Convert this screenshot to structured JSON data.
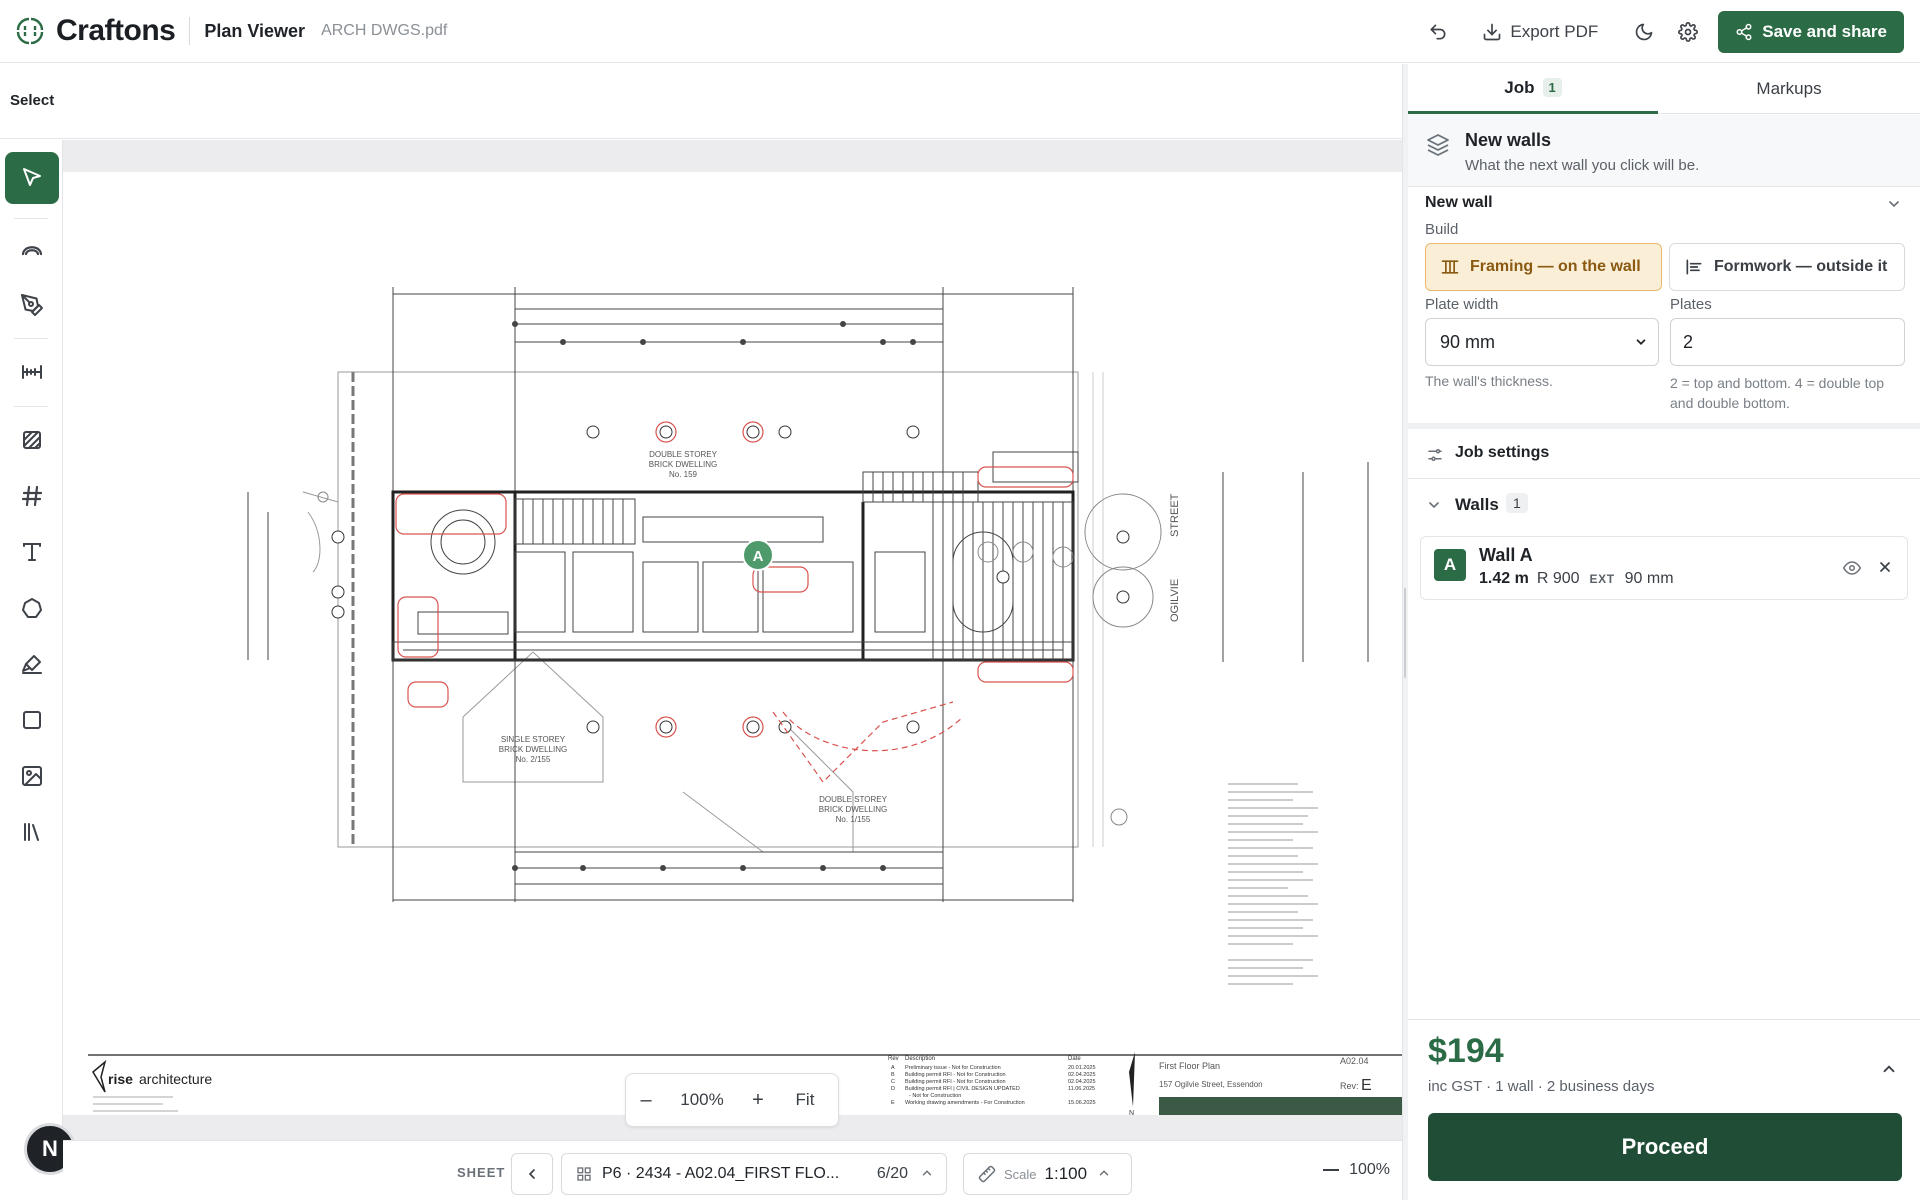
{
  "header": {
    "brand": "Craftons",
    "app_title": "Plan Viewer",
    "file_name": "ARCH DWGS.pdf",
    "export_label": "Export PDF",
    "save_label": "Save and share"
  },
  "mode": {
    "label": "Select"
  },
  "toolbar": {
    "tools": [
      "select-icon",
      "arc-icon",
      "pen-icon",
      "ruler-icon",
      "hatch-icon",
      "grid-icon",
      "text-icon",
      "polygon-icon",
      "highlighter-icon",
      "rectangle-icon",
      "image-icon",
      "library-icon"
    ],
    "active": "select-icon"
  },
  "user": {
    "initial": "N"
  },
  "canvas": {
    "markers": {
      "wall": "A"
    },
    "labels": {
      "double_storey": "DOUBLE STOREY",
      "brick_dwelling": "BRICK DWELLING",
      "no_159": "No. 159",
      "single_storey": "SINGLE STOREY",
      "no_2155": "No. 2/155",
      "no_1155": "No. 1/155",
      "street": "STREET",
      "ogilvie": "OGILVIE"
    },
    "titleblock": {
      "logo_rise": "rise",
      "logo_arch": "architecture",
      "rev_header": "Rev",
      "desc_header": "Description",
      "date_header": "Date",
      "revisions": [
        {
          "rev": "A",
          "desc": "Preliminary issue - Not for Construction",
          "date": "20.01.2025"
        },
        {
          "rev": "B",
          "desc": "Building permit RFI - Not for Construction",
          "date": "02.04.2025"
        },
        {
          "rev": "C",
          "desc": "Building permit RFI - Not for Construction",
          "date": "02.04.2025"
        },
        {
          "rev": "D",
          "desc": "Building permit RFI | CIVIL DESIGN UPDATED",
          "date": "11.06.2025"
        },
        {
          "rev": "",
          "desc": "- Not for Construction",
          "date": ""
        },
        {
          "rev": "E",
          "desc": "Working drawing amendments - For Construction",
          "date": "15.06.2025"
        }
      ],
      "north": "N",
      "drawing_no": "A02.04",
      "drawing_title": "First Floor Plan",
      "address": "157 Ogilvie Street, Essendon",
      "rev_label": "Rev:",
      "rev_value": "E"
    },
    "zoom": {
      "minus": "–",
      "value": "100%",
      "plus": "+",
      "fit": "Fit"
    }
  },
  "bottom": {
    "sheet_label": "SHEET",
    "sheet_name": "P6 · 2434 - A02.04_FIRST FLO...",
    "sheet_page": "6/20",
    "scale_label": "Scale",
    "scale_value": "1:100",
    "zoom": "100%"
  },
  "panel": {
    "tabs": [
      {
        "label": "Job",
        "count": "1"
      },
      {
        "label": "Markups"
      }
    ],
    "new_walls": {
      "title": "New walls",
      "subtitle": "What the next wall you click will be."
    },
    "new_wall": {
      "heading": "New wall",
      "build_label": "Build",
      "options": [
        "Framing — on the wall",
        "Formwork — outside it"
      ],
      "plate_width_label": "Plate width",
      "plate_width_value": "90 mm",
      "plate_width_hint": "The wall's thickness.",
      "plates_label": "Plates",
      "plates_value": "2",
      "plates_hint": "2 = top and bottom. 4 = double top and double bottom."
    },
    "job_settings": "Job settings",
    "walls": {
      "label": "Walls",
      "count": "1",
      "items": [
        {
          "badge": "A",
          "name": "Wall A",
          "length": "1.42 m",
          "rating": "R 900",
          "type": "EXT",
          "width": "90 mm"
        }
      ]
    },
    "price": {
      "amount": "$194",
      "details": "inc GST · 1 wall · 2 business days"
    },
    "proceed_label": "Proceed"
  },
  "colors": {
    "accent": "#2b6b45",
    "proceed": "#1f4d35",
    "framing_bg": "#fbeed7",
    "markup_red": "#d9534f"
  }
}
